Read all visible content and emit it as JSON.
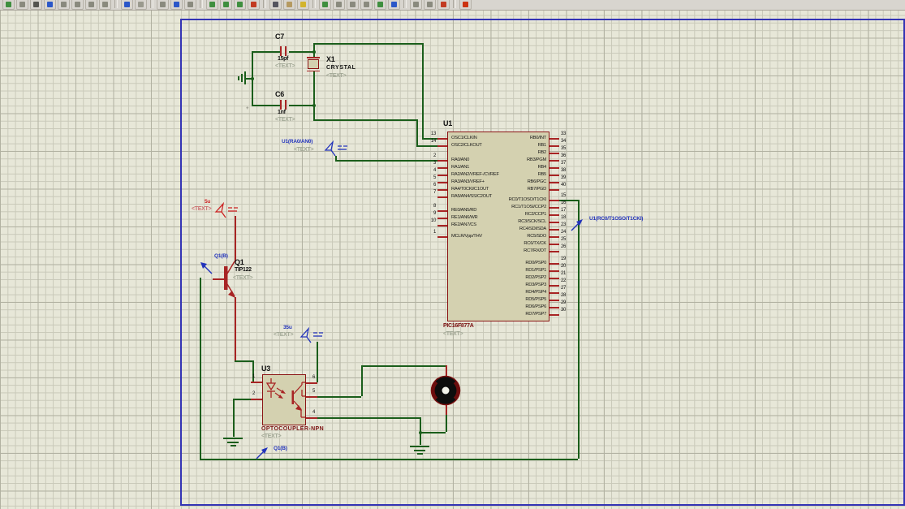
{
  "window": {
    "toolbar_icons": [
      {
        "name": "new-design",
        "color": "#3f8f3f"
      },
      {
        "name": "grid-toggle",
        "color": "#8a8a7e"
      },
      {
        "name": "origin",
        "color": "#555550"
      },
      {
        "name": "goto-center",
        "color": "#2b57c8"
      },
      {
        "name": "zoom-in",
        "color": "#8a8a7e"
      },
      {
        "name": "zoom-out",
        "color": "#8a8a7e"
      },
      {
        "name": "zoom-all",
        "color": "#8a8a7e"
      },
      {
        "name": "zoom-area",
        "color": "#8a8a7e"
      },
      {
        "name": "separator"
      },
      {
        "name": "undo",
        "color": "#2b57c8"
      },
      {
        "name": "redo",
        "color": "#9a9a8e"
      },
      {
        "name": "separator"
      },
      {
        "name": "cut",
        "color": "#8a8a7e"
      },
      {
        "name": "copy",
        "color": "#2b57c8"
      },
      {
        "name": "paste",
        "color": "#8a8a7e"
      },
      {
        "name": "separator"
      },
      {
        "name": "block-copy",
        "color": "#3f8f3f"
      },
      {
        "name": "block-move",
        "color": "#3f8f3f"
      },
      {
        "name": "block-rotate",
        "color": "#3f8f3f"
      },
      {
        "name": "block-delete",
        "color": "#c23b22"
      },
      {
        "name": "separator"
      },
      {
        "name": "selection-mode",
        "color": "#55555f"
      },
      {
        "name": "component-mode",
        "color": "#b59a62"
      },
      {
        "name": "wire-label-mode",
        "color": "#d2b42c"
      },
      {
        "name": "separator"
      },
      {
        "name": "pick-parts",
        "color": "#3f8f3f"
      },
      {
        "name": "junction-dot-mode",
        "color": "#8a8a7e"
      },
      {
        "name": "text-script-mode",
        "color": "#8a8a7e"
      },
      {
        "name": "bus-mode",
        "color": "#8a8a7e"
      },
      {
        "name": "subcircuit-mode",
        "color": "#3f8f3f"
      },
      {
        "name": "instant-edit-mode",
        "color": "#2b57c8"
      },
      {
        "name": "separator"
      },
      {
        "name": "design-explorer",
        "color": "#8a8a7e"
      },
      {
        "name": "new-sheet",
        "color": "#8a8a7e"
      },
      {
        "name": "remove-sheet",
        "color": "#c23b22"
      },
      {
        "name": "separator"
      },
      {
        "name": "exit",
        "color": "#cc3311"
      }
    ]
  },
  "schematic": {
    "markers": {
      "plus": "+"
    },
    "components": {
      "c7": {
        "ref": "C7",
        "value": "15pf",
        "text": "<TEXT>"
      },
      "c6": {
        "ref": "C6",
        "value": "1nf",
        "text": "<TEXT>"
      },
      "x1": {
        "ref": "X1",
        "value": "CRYSTAL",
        "text": "<TEXT>"
      },
      "q1": {
        "ref": "Q1",
        "value": "TIP122",
        "text": "<TEXT>"
      },
      "u3": {
        "ref": "U3",
        "value": "OPTOCOUPLER-NPN",
        "text": "<TEXT>",
        "pin_numbers": {
          "p1": "1",
          "p2": "2",
          "p4": "4",
          "p5": "5",
          "p6": "6"
        }
      },
      "u1": {
        "ref": "U1",
        "value": "PIC16F877A",
        "text": "<TEXT>",
        "pins_left_groups": [
          [
            {
              "num": "13",
              "label": "OSC1/CLKIN"
            },
            {
              "num": "14",
              "label": "OSC2/CLKOUT"
            }
          ],
          [
            {
              "num": "2",
              "label": "RA0/AN0"
            },
            {
              "num": "3",
              "label": "RA1/AN1"
            },
            {
              "num": "4",
              "label": "RA2/AN2/VREF-/CVREF"
            },
            {
              "num": "5",
              "label": "RA3/AN3/VREF+"
            },
            {
              "num": "6",
              "label": "RA4/T0CKI/C1OUT"
            },
            {
              "num": "7",
              "label": "RA5/AN4/SS/C2OUT"
            }
          ],
          [
            {
              "num": "8",
              "label": "RE0/AN5/RD"
            },
            {
              "num": "9",
              "label": "RE1/AN6/WR"
            },
            {
              "num": "10",
              "label": "RE2/AN7/CS"
            }
          ],
          [
            {
              "num": "1",
              "label": "MCLR/Vpp/THV"
            }
          ]
        ],
        "pins_right_groups": [
          [
            {
              "num": "33",
              "label": "RB0/INT"
            },
            {
              "num": "34",
              "label": "RB1"
            },
            {
              "num": "35",
              "label": "RB2"
            },
            {
              "num": "36",
              "label": "RB3/PGM"
            },
            {
              "num": "37",
              "label": "RB4"
            },
            {
              "num": "38",
              "label": "RB5"
            },
            {
              "num": "39",
              "label": "RB6/PGC"
            },
            {
              "num": "40",
              "label": "RB7/PGD"
            }
          ],
          [
            {
              "num": "15",
              "label": "RC0/T1OSO/T1CKI"
            },
            {
              "num": "16",
              "label": "RC1/T1OSI/CCP2"
            },
            {
              "num": "17",
              "label": "RC2/CCP1"
            },
            {
              "num": "18",
              "label": "RC3/SCK/SCL"
            },
            {
              "num": "23",
              "label": "RC4/SDI/SDA"
            },
            {
              "num": "24",
              "label": "RC5/SDO"
            },
            {
              "num": "25",
              "label": "RC6/TX/CK"
            },
            {
              "num": "26",
              "label": "RC7/RX/DT"
            }
          ],
          [
            {
              "num": "19",
              "label": "RD0/PSP0"
            },
            {
              "num": "20",
              "label": "RD1/PSP1"
            },
            {
              "num": "21",
              "label": "RD2/PSP2"
            },
            {
              "num": "22",
              "label": "RD3/PSP3"
            },
            {
              "num": "27",
              "label": "RD4/PSP4"
            },
            {
              "num": "28",
              "label": "RD5/PSP5"
            },
            {
              "num": "29",
              "label": "RD6/PSP6"
            },
            {
              "num": "30",
              "label": "RD7/PSP7"
            }
          ]
        ]
      }
    },
    "terminals": {
      "ra0": {
        "label": "U1(RA0/AN0)",
        "text": "<TEXT>"
      },
      "cap5u": {
        "label": "5u",
        "text": "<TEXT>"
      },
      "cap35u": {
        "label": "35u",
        "text": "<TEXT>"
      },
      "rc0": {
        "label": "U1(RC0/T1OSO/T1CKI)"
      },
      "q1b_base": {
        "label": "Q1(B)"
      },
      "q1b_wire": {
        "label": "Q1(B)"
      }
    },
    "colors": {
      "wire": "#1b5e1b",
      "component": "#8b1515",
      "pin_stub": "#a82424",
      "net_blue": "#2233bb",
      "net_red": "#cc2222",
      "sheet_border": "#3434b4",
      "chip_fill": "#d4d1b0"
    }
  }
}
